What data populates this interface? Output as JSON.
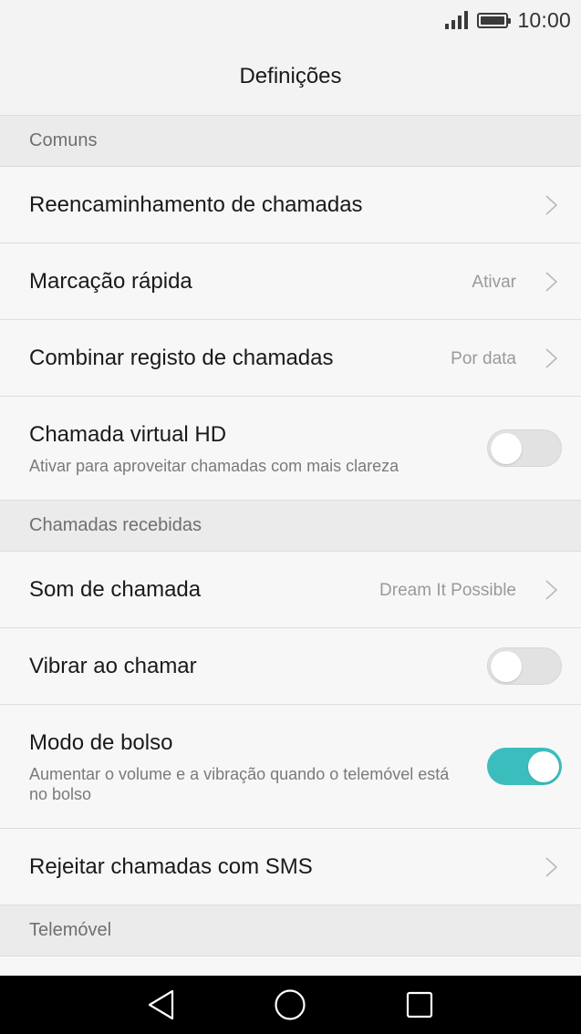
{
  "status_bar": {
    "time": "10:00",
    "icons": [
      "signal-icon",
      "battery-icon"
    ]
  },
  "header": {
    "title": "Definições"
  },
  "sections": {
    "common": {
      "label": "Comuns"
    },
    "incoming": {
      "label": "Chamadas recebidas"
    },
    "phone": {
      "label": "Telemóvel"
    }
  },
  "items": {
    "call_forwarding": {
      "title": "Reencaminhamento de chamadas"
    },
    "speed_dial": {
      "title": "Marcação rápida",
      "value": "Ativar"
    },
    "merge_call_log": {
      "title": "Combinar registo de chamadas",
      "value": "Por data"
    },
    "hd_voice": {
      "title": "Chamada virtual HD",
      "subtitle": "Ativar para aproveitar chamadas com mais clareza",
      "enabled": false
    },
    "ringtone": {
      "title": "Som de chamada",
      "value": "Dream It Possible"
    },
    "vibrate": {
      "title": "Vibrar ao chamar",
      "enabled": false
    },
    "pocket_mode": {
      "title": "Modo de bolso",
      "subtitle": "Aumentar o volume e a vibração quando o telemóvel está no bolso",
      "enabled": true
    },
    "reject_sms": {
      "title": "Rejeitar chamadas com SMS"
    }
  },
  "nav_bar": {
    "buttons": [
      "back-icon",
      "home-icon",
      "recents-icon"
    ]
  },
  "colors": {
    "toggle_on": "#3cbdbd",
    "toggle_off": "#e2e2e2",
    "section_bg": "#ebebeb",
    "row_bg": "#f7f7f7"
  }
}
